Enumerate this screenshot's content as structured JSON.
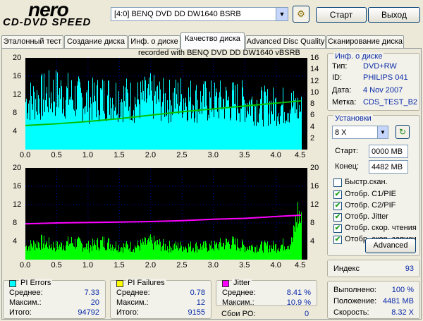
{
  "app": {
    "logo_main": "nero",
    "logo_sub": "CD-DVD SPEED",
    "drive": "[4:0]  BENQ DVD DD DW1640 BSRB",
    "start_button": "Старт",
    "exit_button": "Выход"
  },
  "tabs": [
    {
      "label": "Эталонный тест",
      "active": false
    },
    {
      "label": "Создание диска",
      "active": false
    },
    {
      "label": "Инф. о диске",
      "active": false
    },
    {
      "label": "Качество диска",
      "active": true
    },
    {
      "label": "Advanced Disc Quality",
      "active": false
    },
    {
      "label": "Сканирование диска",
      "active": false
    }
  ],
  "chart_header": "recorded with BENQ    DVD DD DW1640    vBSRB",
  "colors": {
    "pi_errors": "#00ffff",
    "pi_failures": "#ffff00",
    "jitter": "#ff00ff",
    "read_speed": "#00c000",
    "chart_bg": "#000000"
  },
  "chart_data": [
    {
      "type": "bar",
      "name": "top",
      "xlim": [
        0,
        4.5
      ],
      "x_ticks": [
        "0.0",
        "0.5",
        "1.0",
        "1.5",
        "2.0",
        "2.5",
        "3.0",
        "3.5",
        "4.0",
        "4.5"
      ],
      "ylim_left": [
        0,
        20
      ],
      "y_ticks_left": [
        "20",
        "16",
        "12",
        "8",
        "4"
      ],
      "ylim_right": [
        0,
        16
      ],
      "y_ticks_right": [
        "16",
        "14",
        "12",
        "10",
        "8",
        "6",
        "4",
        "2"
      ],
      "series": [
        {
          "color": "#00ffff",
          "x": [
            0,
            0.25,
            0.5,
            0.75,
            1.0,
            1.25,
            1.5,
            1.75,
            2.0,
            2.25,
            2.5,
            2.75,
            3.0,
            3.25,
            3.5,
            3.75,
            4.0,
            4.25,
            4.4
          ],
          "values": [
            11,
            12,
            13,
            12,
            11,
            12,
            12,
            11,
            12,
            11,
            12,
            11,
            11,
            11,
            11,
            10,
            10,
            10,
            9
          ]
        },
        {
          "color": "#00c000",
          "x": [
            0,
            0.5,
            1,
            1.5,
            2,
            2.5,
            3,
            3.5,
            4,
            4.4
          ],
          "values": [
            4.2,
            4.5,
            4.9,
            5.4,
            6.0,
            6.6,
            7.1,
            7.6,
            8.1,
            8.5
          ]
        }
      ]
    },
    {
      "type": "bar",
      "name": "bottom",
      "xlim": [
        0,
        4.5
      ],
      "x_ticks": [
        "0.0",
        "0.5",
        "1.0",
        "1.5",
        "2.0",
        "2.5",
        "3.0",
        "3.5",
        "4.0",
        "4.5"
      ],
      "ylim_left": [
        0,
        20
      ],
      "y_ticks_left": [
        "20",
        "16",
        "12",
        "8",
        "4"
      ],
      "ylim_right": [
        0,
        20
      ],
      "y_ticks_right": [
        "20",
        "16",
        "12",
        "8",
        "4"
      ],
      "series": [
        {
          "color": "#00ff00",
          "x": [
            0,
            0.25,
            0.5,
            0.75,
            1.0,
            1.25,
            1.5,
            1.75,
            2.0,
            2.25,
            2.5,
            2.75,
            3.0,
            3.25,
            3.5,
            3.75,
            4.0,
            4.25,
            4.35,
            4.4
          ],
          "values": [
            3,
            4,
            3,
            4,
            3,
            4,
            3,
            3,
            4,
            3,
            3,
            3,
            3,
            4,
            3,
            3,
            3,
            4,
            11,
            8
          ]
        },
        {
          "color": "#ff00ff",
          "x": [
            0,
            0.5,
            1,
            1.5,
            2,
            2.5,
            3,
            3.5,
            4,
            4.4
          ],
          "values": [
            7.8,
            8.0,
            8.1,
            8.2,
            8.3,
            8.5,
            8.8,
            9.0,
            9.4,
            9.7
          ]
        }
      ]
    }
  ],
  "disc_info": {
    "title": "Инф. о диске",
    "rows": [
      {
        "label": "Тип:",
        "value": "DVD+RW"
      },
      {
        "label": "ID:",
        "value": "PHILIPS 041"
      },
      {
        "label": "Дата:",
        "value": "4 Nov 2007"
      },
      {
        "label": "Метка:",
        "value": "CDS_TEST_B2"
      }
    ]
  },
  "settings": {
    "title": "Установки",
    "speed": "8 X",
    "start_label": "Старт:",
    "start_value": "0000 MB",
    "end_label": "Конец:",
    "end_value": "4482 MB",
    "checks": [
      {
        "label": "Быстр.скан.",
        "checked": false
      },
      {
        "label": "Отобр. C1/PIE",
        "checked": true
      },
      {
        "label": "Отобр. C2/PIF",
        "checked": true
      },
      {
        "label": "Отобр. Jitter",
        "checked": true
      },
      {
        "label": "Отобр. скор. чтения",
        "checked": true
      },
      {
        "label": "Отобр. скор. записи",
        "checked": true
      }
    ],
    "advanced_button": "Advanced"
  },
  "index": {
    "label": "Индекс",
    "value": "93"
  },
  "progress": {
    "rows": [
      {
        "label": "Выполнено:",
        "value": "100 %"
      },
      {
        "label": "Положение:",
        "value": "4481 MB"
      },
      {
        "label": "Скорость:",
        "value": "8.32 X"
      }
    ]
  },
  "stats": {
    "pi_errors": {
      "title": "PI Errors",
      "rows": [
        {
          "label": "Среднее:",
          "value": "7.33"
        },
        {
          "label": "Максим.:",
          "value": "20"
        },
        {
          "label": "Итого:",
          "value": "94792"
        }
      ]
    },
    "pi_failures": {
      "title": "PI Failures",
      "rows": [
        {
          "label": "Среднее:",
          "value": "0.78"
        },
        {
          "label": "Максим.:",
          "value": "12"
        },
        {
          "label": "Итого:",
          "value": "9155"
        }
      ]
    },
    "jitter": {
      "title": "Jitter",
      "rows": [
        {
          "label": "Среднее:",
          "value": "8.41 %"
        },
        {
          "label": "Максим.:",
          "value": "10.9 %"
        }
      ]
    },
    "po_failures": {
      "label": "Сбои PO:",
      "value": "0"
    }
  }
}
